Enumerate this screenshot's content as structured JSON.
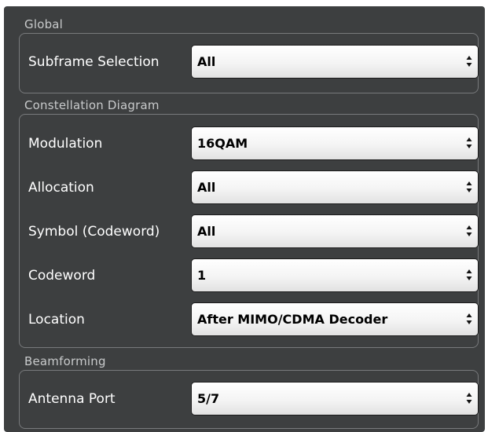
{
  "groups": {
    "global": {
      "title": "Global",
      "fields": {
        "subframe_selection": {
          "label": "Subframe Selection",
          "value": "All"
        }
      }
    },
    "constellation": {
      "title": "Constellation Diagram",
      "fields": {
        "modulation": {
          "label": "Modulation",
          "value": "16QAM"
        },
        "allocation": {
          "label": "Allocation",
          "value": "All"
        },
        "symbol": {
          "label": "Symbol (Codeword)",
          "value": "All"
        },
        "codeword": {
          "label": "Codeword",
          "value": "1"
        },
        "location": {
          "label": "Location",
          "value": "After MIMO/CDMA Decoder"
        }
      }
    },
    "beamforming": {
      "title": "Beamforming",
      "fields": {
        "antenna_port": {
          "label": "Antenna Port",
          "value": "5/7"
        }
      }
    }
  },
  "icons": {
    "dropdown": "up-down-arrows-icon"
  },
  "colors": {
    "panel_background": "#3d3f40",
    "group_border": "#787a7c",
    "label_text": "#ffffff",
    "group_title_text": "#c8cacb",
    "select_background": "#f4f4f4"
  }
}
